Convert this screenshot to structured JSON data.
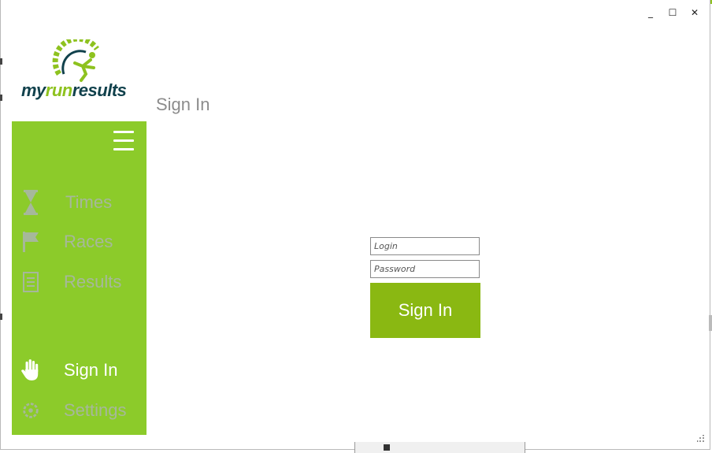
{
  "window": {
    "controls": {
      "minimize": "_",
      "maximize": "☐",
      "close": "✕"
    }
  },
  "logo": {
    "part1": "my",
    "part2": "run",
    "part3": "results"
  },
  "page": {
    "title": "Sign In"
  },
  "sidebar": {
    "items": [
      {
        "label": "Times",
        "icon": "hourglass-icon"
      },
      {
        "label": "Races",
        "icon": "flag-icon"
      },
      {
        "label": "Results",
        "icon": "document-icon"
      },
      {
        "label": "Sign In",
        "icon": "hand-icon"
      },
      {
        "label": "Settings",
        "icon": "gear-icon"
      }
    ]
  },
  "form": {
    "login_placeholder": "Login",
    "password_placeholder": "Password",
    "signin_label": "Sign In"
  },
  "colors": {
    "accent": "#8ccb2a",
    "button": "#8ab812",
    "logo_dark": "#11414c"
  }
}
